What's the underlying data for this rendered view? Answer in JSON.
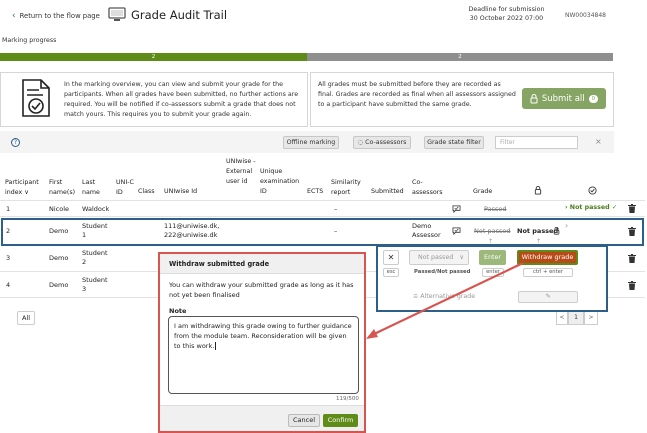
{
  "header": {
    "back_label": "Return to the flow page",
    "title": "Grade Audit Trail",
    "deadline_label": "Deadline for submission",
    "deadline_value": "30 October 2022 07:00",
    "flow_id": "NW00034848"
  },
  "progress": {
    "label": "Marking progress",
    "done_count": "2",
    "remaining_count": "2",
    "done_fraction": 0.5
  },
  "info": {
    "text": "In the marking overview, you can view and submit your grade for the participants. When all grades have been submitted, no further actions are required. You will be notified if co-assessors submit a grade that does not match yours. This requires you to submit your grade again."
  },
  "submit_panel": {
    "text": "All grades must be submitted before they are recorded as final. Grades are recorded as final when all assessors assigned to a participant have submitted the same grade.",
    "button_label": "Submit all",
    "count": "0"
  },
  "toolbar": {
    "help": "?",
    "offline_marking": "Offline marking",
    "co_assessors": "Co-assessors",
    "grade_state_filter": "Grade state filter",
    "filter_placeholder": "Filter",
    "clear": "×"
  },
  "table": {
    "headers": {
      "index": "Participant index",
      "first": "First name(s)",
      "last": "Last name",
      "unicid": "UNI-C ID",
      "class": "Class",
      "uniwise": "UNIwise Id",
      "ext": "UNIwise - External user id",
      "exam": "Unique examination ID",
      "ects": "ECTS",
      "sim": "Similarity report",
      "submitted": "Submitted",
      "co": "Co-assessors",
      "grade": "Grade"
    },
    "rows": [
      {
        "index": "1",
        "first": "Nicole",
        "last": "Waldock",
        "similarity": "–",
        "co": "",
        "grade": "Passed",
        "final_grade": "Not passed"
      },
      {
        "index": "2",
        "first": "Demo",
        "last": "Student 1",
        "uniwise": "111@uniwise.dk, 222@uniwise.dk",
        "similarity": "–",
        "co": "Demo Assessor",
        "grade": "Not passed",
        "final_grade": "Not passed"
      },
      {
        "index": "3",
        "first": "Demo",
        "last": "Student 2"
      },
      {
        "index": "4",
        "first": "Demo",
        "last": "Student 3"
      }
    ]
  },
  "grade_panel": {
    "select_value": "Not passed",
    "enter_label": "Enter",
    "esc_label": "esc",
    "passed_hint": "Passed/Not passed",
    "enter_key": "enter",
    "alt_label": "Alternative grade",
    "withdraw_label": "Withdraw grade",
    "ctrl_enter": "ctrl + enter"
  },
  "dialog": {
    "title": "Withdraw submitted grade",
    "body": "You can withdraw your submitted grade as long as it has not yet been finalised",
    "note_label": "Note",
    "note_value": "I am withdrawing this grade owing to further guidance from the module team. Reconsideration will be given to this work.",
    "counter": "119/500",
    "cancel": "Cancel",
    "confirm": "Confirm"
  },
  "pagination": {
    "all": "All",
    "prev": "<",
    "page": "1",
    "next": ">"
  },
  "colors": {
    "accent_green": "#5f8c18",
    "submit_green": "#86a564",
    "selection_blue": "#2c5f8a",
    "withdraw_orange": "#b84a18",
    "callout_red": "#d9534f"
  }
}
